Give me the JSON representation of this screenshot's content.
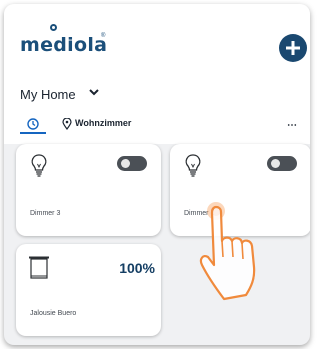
{
  "app": {
    "brand": "mediola",
    "add_button_icon": "plus-icon"
  },
  "home": {
    "title": "My Home",
    "tabs": [
      {
        "icon": "clock-icon",
        "label": "",
        "active": true
      },
      {
        "icon": "location-pin-icon",
        "label": "Wohnzimmer",
        "active": false
      }
    ],
    "more_icon": "⋯"
  },
  "devices": [
    {
      "name": "Dimmer 3",
      "icon": "light-bulb-icon",
      "state": "toggle"
    },
    {
      "name": "Dimmer 1",
      "icon": "light-bulb-icon",
      "state": "toggle"
    },
    {
      "name": "Jalousie Buero",
      "icon": "blind-icon",
      "value": "100%"
    }
  ],
  "colors": {
    "brand": "#1b4f7a",
    "accent": "#1565c0",
    "toggle": "#4b5056",
    "background": "#f0f1f3"
  }
}
